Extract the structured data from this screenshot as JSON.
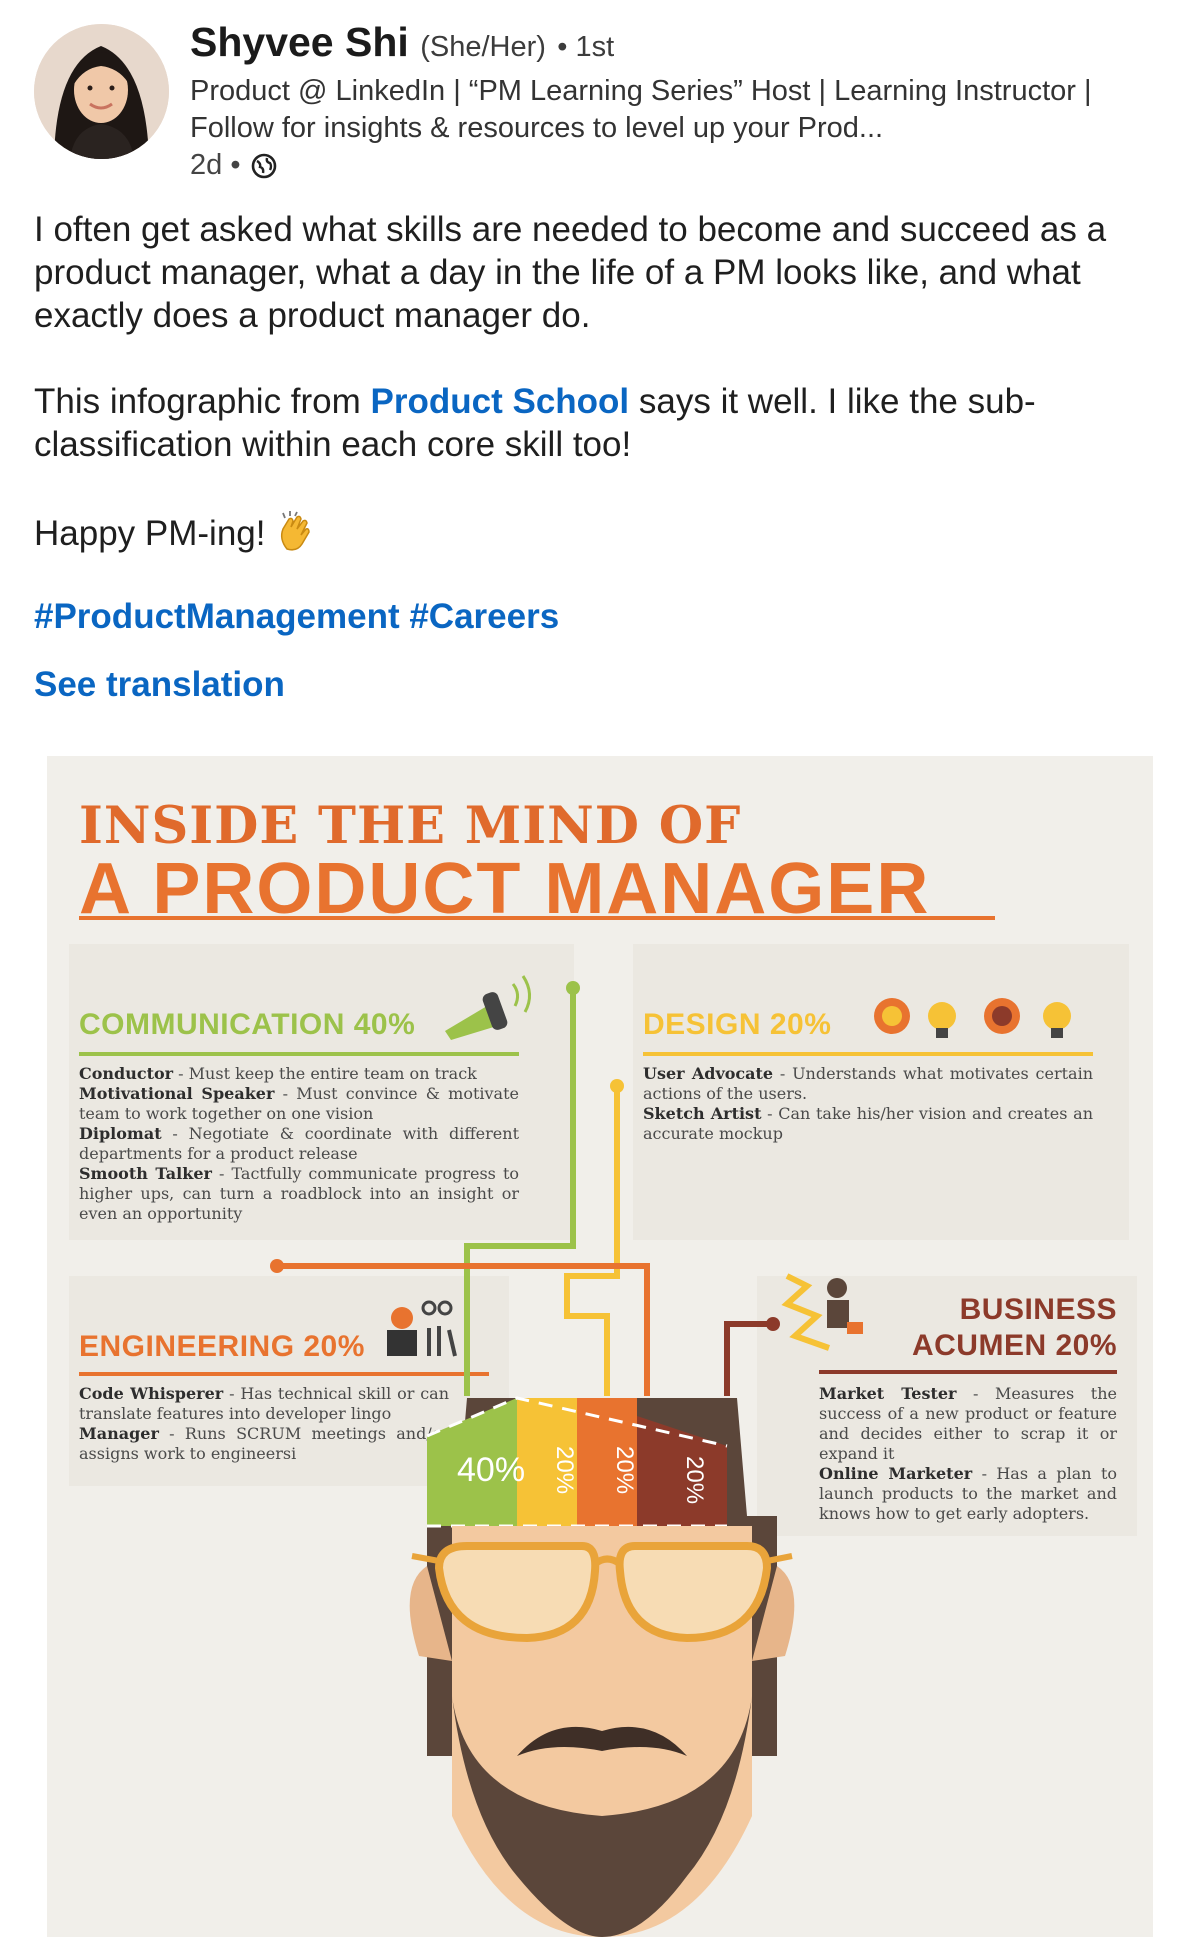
{
  "post": {
    "author": {
      "name": "Shyvee Shi",
      "pronouns": "(She/Her)",
      "connection": "• 1st",
      "headline": "Product @ LinkedIn | “PM Learning Series” Host | Learning Instructor | Follow for insights & resources to level up your Prod...",
      "time": "2d •",
      "visibility_icon": "globe-icon"
    },
    "body": {
      "para1": "I often get asked what skills are needed to become and succeed as a product manager, what a day in the life of a PM looks like, and what exactly does a product manager do.",
      "para2_before": "This infographic from ",
      "para2_link": "Product School",
      "para2_after": " says it well. I like the sub-classification within each core skill too!",
      "para3": "Happy PM-ing!",
      "emoji": "clapping-hands-icon"
    },
    "hashtags": "#ProductManagement #Careers",
    "see_translation": "See translation"
  },
  "infographic": {
    "title_line1": "INSIDE THE MIND OF",
    "title_line2": "A PRODUCT MANAGER",
    "colors": {
      "communication": "#9cc24a",
      "design": "#f6c236",
      "engineering": "#e8732f",
      "business": "#8c3a2a",
      "title": "#e8732f",
      "skin": "#f3c9a0",
      "hair": "#5b463a"
    },
    "communication": {
      "title": "COMMUNICATION 40%",
      "skills": [
        {
          "name": "Conductor",
          "desc": " - Must keep the entire team on track"
        },
        {
          "name": "Motivational Speaker",
          "desc": " - Must convince & motivate team to work together on one vision"
        },
        {
          "name": "Diplomat",
          "desc": " - Negotiate & coordinate with different departments for a product release"
        },
        {
          "name": "Smooth Talker",
          "desc": " - Tactfully communicate progress to higher ups, can turn a roadblock into an insight or even an opportunity"
        }
      ]
    },
    "design": {
      "title": "DESIGN 20%",
      "skills": [
        {
          "name": "User Advocate",
          "desc": " - Understands what motivates certain actions of the users."
        },
        {
          "name": "Sketch Artist",
          "desc": " - Can take his/her vision and creates an accurate mockup"
        }
      ]
    },
    "engineering": {
      "title": "ENGINEERING 20%",
      "skills": [
        {
          "name": "Code Whisperer",
          "desc": " - Has technical skill or can translate features into developer lingo"
        },
        {
          "name": "Manager",
          "desc": " - Runs SCRUM meetings and/or assigns work to engineersi"
        }
      ]
    },
    "business": {
      "title_line1": "BUSINESS",
      "title_line2": "ACUMEN 20%",
      "skills": [
        {
          "name": "Market Tester",
          "desc": " - Measures the success of a new product or feature and decides either to scrap it or expand it"
        },
        {
          "name": "Online Marketer",
          "desc": " - Has a plan to launch products to the market and knows how to get early adopters."
        }
      ]
    },
    "head_segments": [
      {
        "label": "40%",
        "value": 40
      },
      {
        "label": "20%",
        "value": 20
      },
      {
        "label": "20%",
        "value": 20
      },
      {
        "label": "20%",
        "value": 20
      }
    ]
  }
}
